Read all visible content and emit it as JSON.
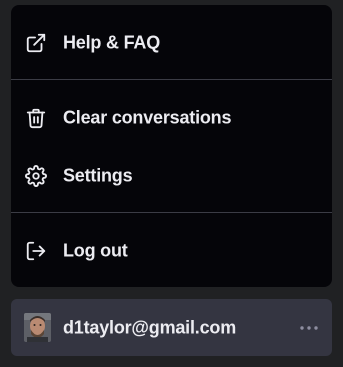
{
  "menu": {
    "items": [
      {
        "label": "Help & FAQ",
        "icon": "external-link-icon"
      },
      {
        "label": "Clear conversations",
        "icon": "trash-icon"
      },
      {
        "label": "Settings",
        "icon": "gear-icon"
      },
      {
        "label": "Log out",
        "icon": "logout-icon"
      }
    ]
  },
  "account": {
    "email": "d1taylor@gmail.com",
    "more_icon": "more-horizontal-icon"
  },
  "colors": {
    "background": "#202123",
    "menu_background": "#050509",
    "account_background": "#343541",
    "text": "#ececf1",
    "divider": "#3b3c45",
    "muted": "#8e8ea0"
  }
}
